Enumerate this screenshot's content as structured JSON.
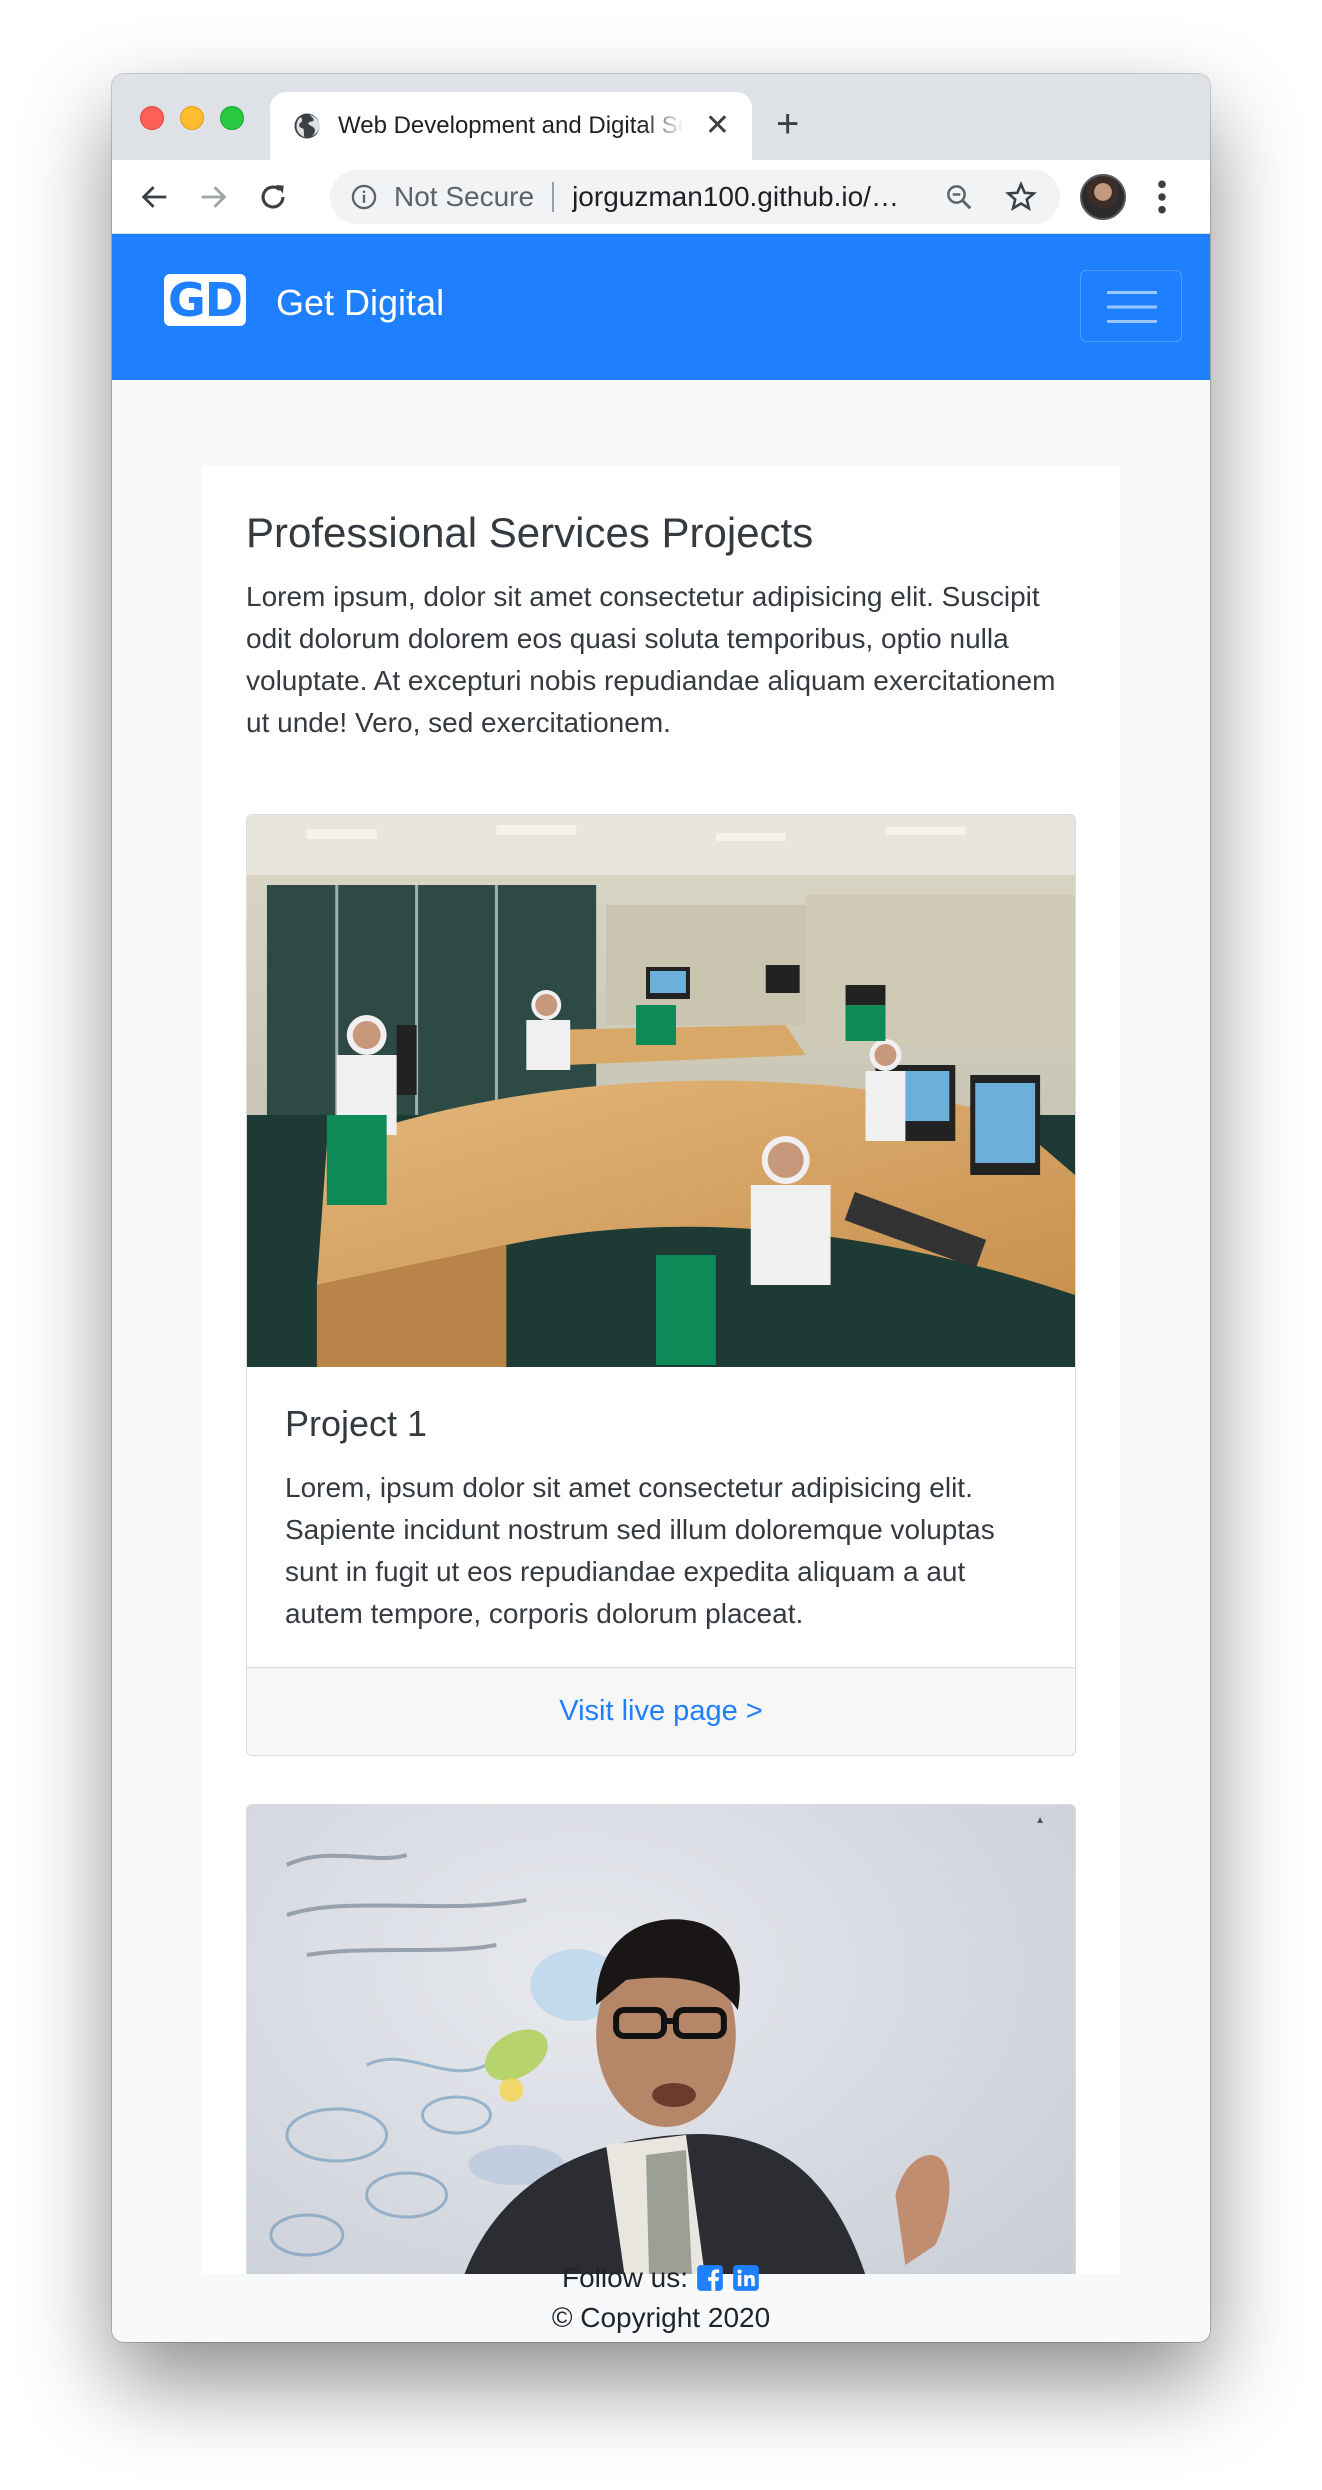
{
  "browser": {
    "tab_title": "Web Development and Digital Services",
    "new_tab_icon": "plus-icon",
    "security_label": "Not Secure",
    "url": "jorguzman100.github.io/…",
    "icons": [
      "back-arrow-icon",
      "forward-arrow-icon",
      "reload-icon",
      "info-icon",
      "zoom-icon",
      "star-icon",
      "kebab-menu-icon"
    ]
  },
  "navbar": {
    "logo_text": "GD",
    "brand": "Get Digital",
    "bg_color": "#1e80ff"
  },
  "main": {
    "title": "Professional Services Projects",
    "intro": "Lorem ipsum, dolor sit amet consectetur adipisicing elit. Suscipit odit dolorum dolorem eos quasi soluta temporibus, optio nulla voluptate. At excepturi nobis repudiandae aliquam exercitationem ut unde! Vero, sed exercitationem.",
    "projects": [
      {
        "title": "Project 1",
        "text": "Lorem, ipsum dolor sit amet consectetur adipisicing elit. Sapiente incidunt nostrum sed illum doloremque voluptas sunt in fugit ut eos repudiandae expedita aliquam a aut autem tempore, corporis dolorum placeat.",
        "link": "Visit live page >"
      }
    ]
  },
  "footer": {
    "follow_label": "Follow us:",
    "social_icons": [
      "facebook-icon",
      "linkedin-icon"
    ],
    "copyright": "© Copyright 2020"
  }
}
